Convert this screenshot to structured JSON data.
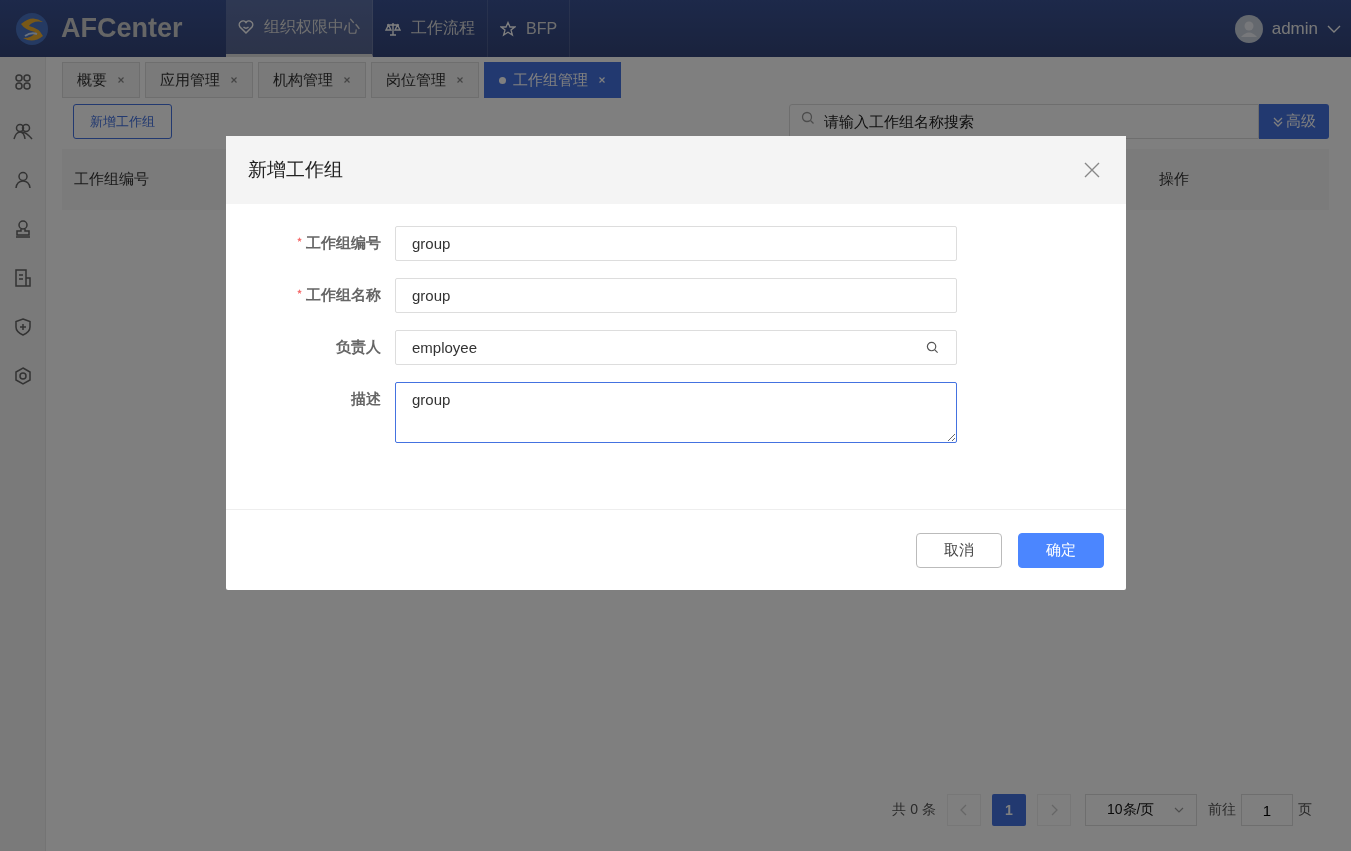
{
  "header": {
    "logo_text": "AFCenter",
    "nav": [
      {
        "label": "组织权限中心",
        "selected": true
      },
      {
        "label": "工作流程",
        "selected": false
      },
      {
        "label": "BFP",
        "selected": false
      }
    ],
    "user": "admin"
  },
  "tabs": [
    {
      "label": "概要",
      "selected": false
    },
    {
      "label": "应用管理",
      "selected": false
    },
    {
      "label": "机构管理",
      "selected": false
    },
    {
      "label": "岗位管理",
      "selected": false
    },
    {
      "label": "工作组管理",
      "selected": true
    }
  ],
  "toolbar": {
    "add_button": "新增工作组",
    "search_placeholder": "请输入工作组名称搜索",
    "advanced_button": "高级"
  },
  "table": {
    "columns": [
      "工作组编号",
      "操作"
    ]
  },
  "pagination": {
    "total": "共 0 条",
    "pages": [
      {
        "label": "1",
        "selected": true
      }
    ],
    "page_size": "10条/页",
    "goto_label": "前往",
    "goto_value": "1",
    "page_suffix": "页"
  },
  "dialog": {
    "title": "新增工作组",
    "fields": [
      {
        "label": "工作组编号",
        "required": true,
        "kind": "text",
        "value": "group",
        "focused": false
      },
      {
        "label": "工作组名称",
        "required": true,
        "kind": "text",
        "value": "group",
        "focused": false
      },
      {
        "label": "负责人",
        "required": false,
        "kind": "search",
        "value": "employee",
        "focused": false
      },
      {
        "label": "描述",
        "required": false,
        "kind": "textarea",
        "value": "group",
        "focused": true
      }
    ],
    "buttons": [
      {
        "label": "取消",
        "kind": "default"
      },
      {
        "label": "确定",
        "kind": "primary"
      }
    ]
  }
}
